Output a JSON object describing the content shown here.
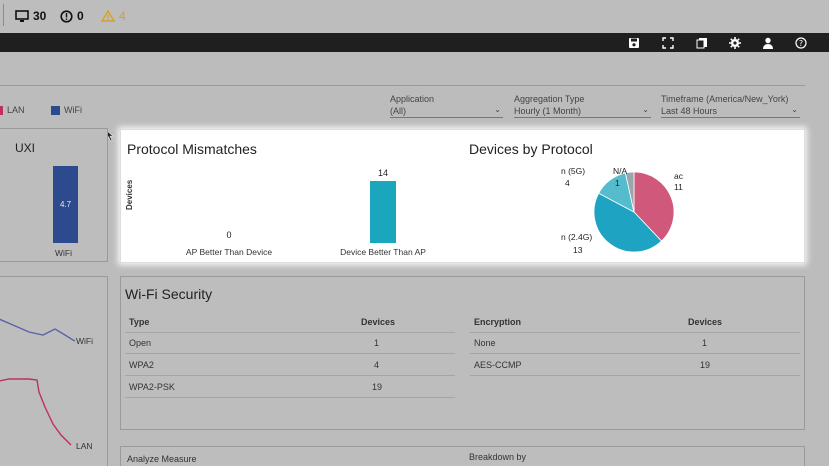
{
  "statusbar": {
    "devices_count": "30",
    "issues_count": "0",
    "warnings_count": "4",
    "icons": [
      "monitor-icon",
      "alert-circle-icon",
      "warning-triangle-icon"
    ]
  },
  "toolbar": {
    "icons": [
      "save-icon",
      "fullscreen-icon",
      "export-icon",
      "settings-icon",
      "user-icon",
      "help-icon"
    ]
  },
  "legend": {
    "items": [
      {
        "label": "LAN"
      },
      {
        "label": "WiFi",
        "color": "#2e4a8e"
      }
    ]
  },
  "filters": {
    "application": {
      "label": "Application",
      "value": "(All)"
    },
    "aggregation": {
      "label": "Aggregation Type",
      "value": "Hourly (1 Month)"
    },
    "timeframe": {
      "label": "Timeframe (America/New_York)",
      "value": "Last 48 Hours"
    }
  },
  "uxi_panel": {
    "title": "UXI",
    "bar_value": "4.7",
    "bar_label": "WiFi",
    "bar_color": "#2e4a8e"
  },
  "line_panel": {
    "wifi_label": "WiFi",
    "lan_label": "LAN",
    "wifi_color": "#5a63a8",
    "lan_color": "#c0305a"
  },
  "protocol_mismatches": {
    "title": "Protocol Mismatches",
    "ylabel": "Devices",
    "chart_data": {
      "type": "bar",
      "categories": [
        "AP Better Than Device",
        "Device Better Than AP"
      ],
      "values": [
        0,
        14
      ],
      "color": "#1aa7be"
    }
  },
  "devices_by_protocol": {
    "title": "Devices by Protocol",
    "chart_data": {
      "type": "pie",
      "slices": [
        {
          "label": "ac",
          "value": 11,
          "color": "#d0587a"
        },
        {
          "label": "n (2.4G)",
          "value": 13,
          "color": "#1ea3c2"
        },
        {
          "label": "n (5G)",
          "value": 4,
          "color": "#54bccd"
        },
        {
          "label": "N/A",
          "value": 1,
          "color": "#9aa6ae"
        }
      ]
    }
  },
  "wifi_security": {
    "title": "Wi-Fi Security",
    "type_table": {
      "headers": [
        "Type",
        "Devices"
      ],
      "rows": [
        [
          "Open",
          "1"
        ],
        [
          "WPA2",
          "4"
        ],
        [
          "WPA2-PSK",
          "19"
        ]
      ]
    },
    "encryption_table": {
      "headers": [
        "Encryption",
        "Devices"
      ],
      "rows": [
        [
          "None",
          "1"
        ],
        [
          "AES-CCMP",
          "19"
        ]
      ]
    }
  },
  "analyze": {
    "measure_label": "Analyze Measure",
    "breakdown_label": "Breakdown by"
  }
}
